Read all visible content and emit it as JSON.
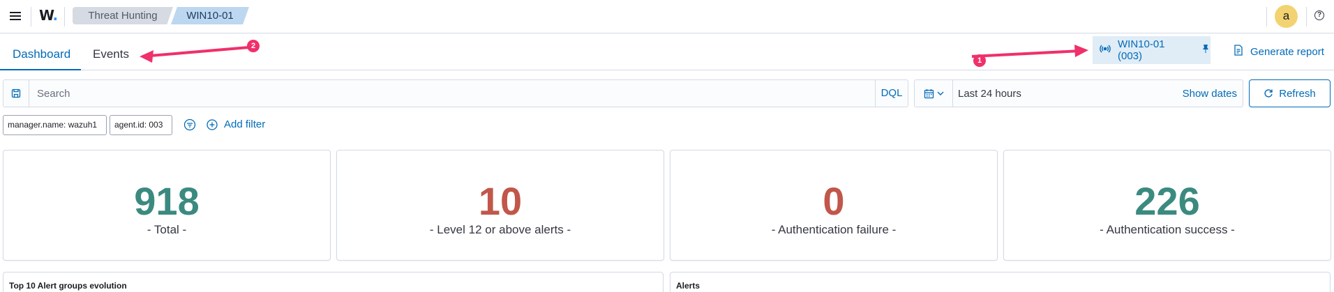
{
  "header": {
    "logo_text": "W",
    "logo_dot": ".",
    "breadcrumbs": [
      "Threat Hunting",
      "WIN10-01"
    ],
    "avatar_initial": "a",
    "help_glyph": "?"
  },
  "tabs": {
    "items": [
      {
        "label": "Dashboard",
        "active": true
      },
      {
        "label": "Events",
        "active": false
      }
    ],
    "agent_pill_label": "WIN10-01 (003)",
    "generate_report_label": "Generate report"
  },
  "annotations": [
    {
      "number": "1"
    },
    {
      "number": "2"
    }
  ],
  "query": {
    "placeholder": "Search",
    "language_label": "DQL",
    "date_range_label": "Last 24 hours",
    "show_dates_label": "Show dates",
    "refresh_label": "Refresh"
  },
  "filters": {
    "pills": [
      "manager.name: wazuh1",
      "agent.id: 003"
    ],
    "add_filter_label": "Add filter"
  },
  "metrics": [
    {
      "value": "918",
      "label": "- Total -",
      "color": "#3b8a80"
    },
    {
      "value": "10",
      "label": "- Level 12 or above alerts -",
      "color": "#c0574a"
    },
    {
      "value": "0",
      "label": "- Authentication failure -",
      "color": "#c0574a"
    },
    {
      "value": "226",
      "label": "- Authentication success -",
      "color": "#3b8a80"
    }
  ],
  "panels": [
    {
      "title": "Top 10 Alert groups evolution"
    },
    {
      "title": "Alerts"
    }
  ],
  "colors": {
    "accent": "#006bb8",
    "annotation": "#f0306a",
    "positive": "#3b8a80",
    "negative": "#c0574a"
  }
}
